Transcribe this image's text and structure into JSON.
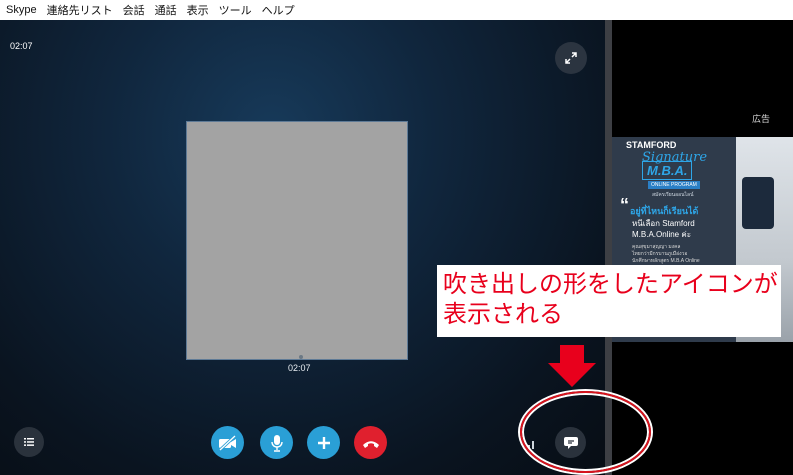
{
  "menu": {
    "items": [
      "Skype",
      "連絡先リスト",
      "会話",
      "通話",
      "表示",
      "ツール",
      "ヘルプ"
    ]
  },
  "call": {
    "timer_top": "02:07",
    "timer_bottom": "02:07"
  },
  "sidebar": {
    "ad_label": "広告",
    "ad": {
      "brand": "STAMFORD",
      "signature": "Signature",
      "mba": "M.B.A.",
      "program": "ONLINE PROGRAM",
      "sub": "สมัครเรียนออนไลน์",
      "line1": "อยู่ที่ไหนก็เรียนได้",
      "line2": "หนีเลือก Stamford",
      "line3": "M.B.A.Online ค่ะ",
      "small1": "คุณสุขุมาสุญญา มงคล",
      "small2": "ไทยกว่ามีกรบานภูเมือ่งวอ",
      "small3": "นักศึกษาหลักสูตร M.B.A Online"
    }
  },
  "annotation": {
    "callout_text": "吹き出しの形をしたアイコンが表示される",
    "color": "#e8001c"
  },
  "colors": {
    "accent": "#2a9fd6",
    "hangup": "#e0202e",
    "dark_button": "#2a323c"
  },
  "icons": [
    "expand-icon",
    "list-icon",
    "video-off-icon",
    "microphone-icon",
    "plus-icon",
    "hang-up-icon",
    "signal-icon",
    "chat-bubble-icon",
    "down-arrow-icon"
  ]
}
